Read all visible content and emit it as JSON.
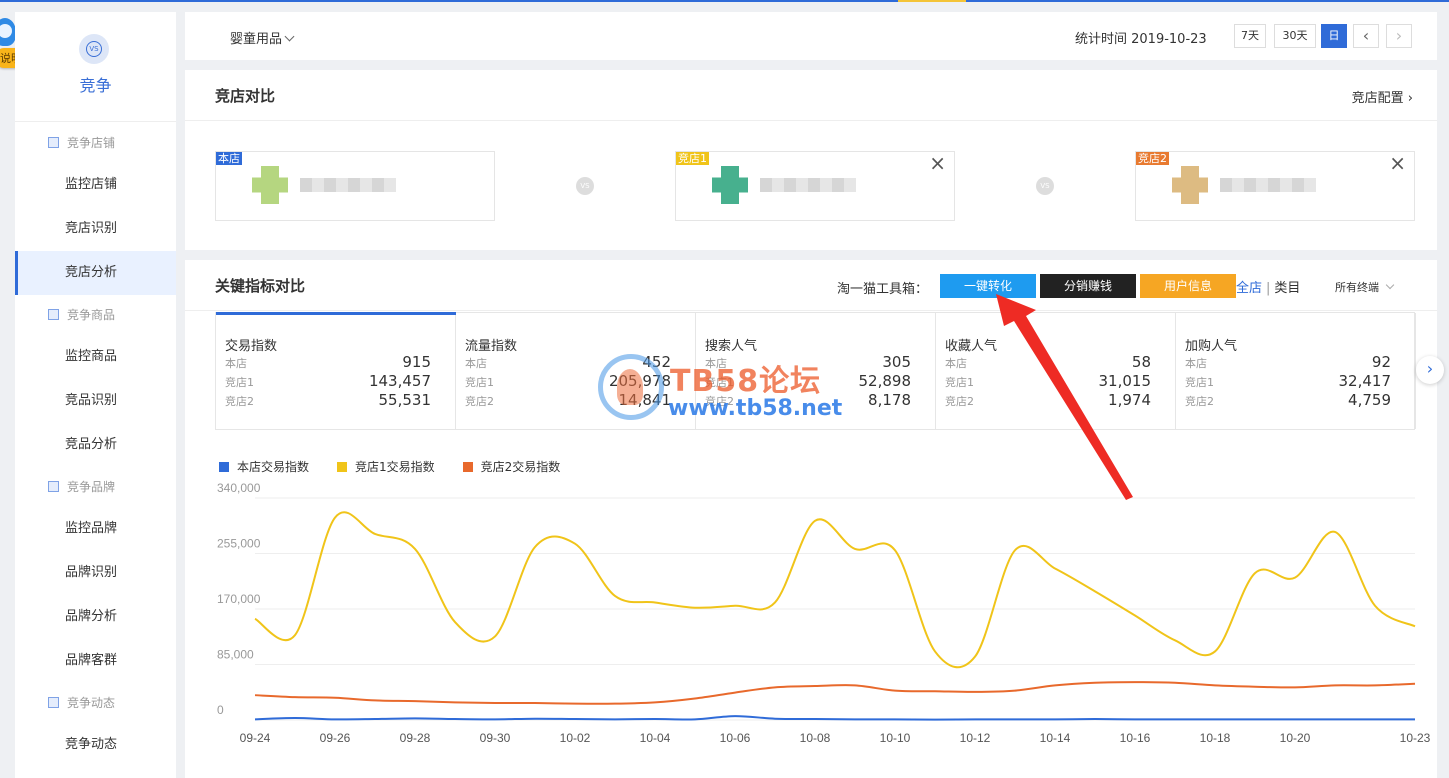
{
  "helper": {
    "tag": "说明"
  },
  "sidebar": {
    "title": "竞争",
    "vs_logo": "VS",
    "sections": [
      {
        "label": "竞争店铺",
        "items": [
          "监控店铺",
          "竞店识别",
          "竞店分析"
        ]
      },
      {
        "label": "竞争商品",
        "items": [
          "监控商品",
          "竞品识别",
          "竞品分析"
        ]
      },
      {
        "label": "竞争品牌",
        "items": [
          "监控品牌",
          "品牌识别",
          "品牌分析",
          "品牌客群"
        ]
      },
      {
        "label": "竞争动态",
        "items": [
          "竞争动态"
        ]
      }
    ],
    "active_item": "竞店分析"
  },
  "filterbar": {
    "category": "婴童用品",
    "stat_time": "统计时间 2019-10-23",
    "range_7": "7天",
    "range_30": "30天",
    "range_day": "日",
    "prev": "‹",
    "next": "›"
  },
  "compare": {
    "title": "竞店对比",
    "config_link": "竞店配置 ›",
    "vs": "VS",
    "shops": [
      {
        "tag": "本店",
        "tag_color": "#2f6bd8",
        "avatar_color": "#a9cf6a"
      },
      {
        "tag": "竞店1",
        "tag_color": "#f0c419",
        "avatar_color": "#27a37b"
      },
      {
        "tag": "竞店2",
        "tag_color": "#e87a30",
        "avatar_color": "#d8b06d"
      }
    ],
    "close": "×"
  },
  "kpi": {
    "title": "关键指标对比",
    "toolbox_label": "淘一猫工具箱：",
    "tools": [
      {
        "label": "一键转化",
        "color": "#1e9bf0"
      },
      {
        "label": "分销赚钱",
        "color": "#222222"
      },
      {
        "label": "用户信息",
        "color": "#f6a623"
      }
    ],
    "scope_all": "全店",
    "scope_sep": "|",
    "scope_cat": "类目",
    "terminal": "所有终端",
    "next_icon": "›",
    "cards": [
      {
        "title": "交易指数",
        "rows": [
          {
            "name": "本店",
            "value": "915"
          },
          {
            "name": "竞店1",
            "value": "143,457"
          },
          {
            "name": "竞店2",
            "value": "55,531"
          }
        ]
      },
      {
        "title": "流量指数",
        "rows": [
          {
            "name": "本店",
            "value": "452"
          },
          {
            "name": "竞店1",
            "value": "205,978"
          },
          {
            "name": "竞店2",
            "value": "14,841"
          }
        ]
      },
      {
        "title": "搜索人气",
        "rows": [
          {
            "name": "本店",
            "value": "305"
          },
          {
            "name": "竞店1",
            "value": "52,898"
          },
          {
            "name": "竞店2",
            "value": "8,178"
          }
        ]
      },
      {
        "title": "收藏人气",
        "rows": [
          {
            "name": "本店",
            "value": "58"
          },
          {
            "name": "竞店1",
            "value": "31,015"
          },
          {
            "name": "竞店2",
            "value": "1,974"
          }
        ]
      },
      {
        "title": "加购人气",
        "rows": [
          {
            "name": "本店",
            "value": "92"
          },
          {
            "name": "竞店1",
            "value": "32,417"
          },
          {
            "name": "竞店2",
            "value": "4,759"
          }
        ]
      }
    ]
  },
  "watermark": {
    "top": "TB58论坛",
    "bottom": "www.tb58.net"
  },
  "chart_data": {
    "type": "line",
    "ylim": [
      0,
      340000
    ],
    "yticks": [
      "340,000",
      "255,000",
      "170,000",
      "85,000",
      "0"
    ],
    "ytick_values": [
      340000,
      255000,
      170000,
      85000,
      0
    ],
    "x": [
      "09-24",
      "09-25",
      "09-26",
      "09-27",
      "09-28",
      "09-29",
      "09-30",
      "10-01",
      "10-02",
      "10-03",
      "10-04",
      "10-05",
      "10-06",
      "10-07",
      "10-08",
      "10-09",
      "10-10",
      "10-11",
      "10-12",
      "10-13",
      "10-14",
      "10-15",
      "10-16",
      "10-17",
      "10-18",
      "10-19",
      "10-20",
      "10-21",
      "10-22",
      "10-23"
    ],
    "xtick_labels": [
      "09-24",
      "09-26",
      "09-28",
      "09-30",
      "10-02",
      "10-04",
      "10-06",
      "10-08",
      "10-10",
      "10-12",
      "10-14",
      "10-16",
      "10-18",
      "10-20",
      "10-23"
    ],
    "series": [
      {
        "name": "本店交易指数",
        "color": "#2f6bd8",
        "values": [
          1000,
          3000,
          1000,
          1500,
          2500,
          1500,
          1000,
          2000,
          1500,
          1000,
          1500,
          1000,
          6000,
          2000,
          1500,
          1000,
          1000,
          500,
          1000,
          1000,
          1000,
          1500,
          1000,
          1000,
          1000,
          1000,
          1000,
          1000,
          1000,
          915
        ]
      },
      {
        "name": "竞店1交易指数",
        "color": "#f0c419",
        "values": [
          155000,
          130000,
          310000,
          285000,
          262000,
          150000,
          128000,
          265000,
          270000,
          190000,
          180000,
          172000,
          175000,
          180000,
          305000,
          262000,
          260000,
          105000,
          97000,
          260000,
          232000,
          197000,
          160000,
          122000,
          105000,
          225000,
          218000,
          288000,
          175000,
          143457
        ]
      },
      {
        "name": "竞店2交易指数",
        "color": "#e8692c",
        "values": [
          38000,
          35000,
          34000,
          30000,
          29000,
          27000,
          26000,
          26000,
          25000,
          25000,
          27000,
          33000,
          42000,
          50000,
          52000,
          53000,
          45000,
          44000,
          43000,
          45000,
          53000,
          57000,
          58000,
          57000,
          53000,
          51000,
          50000,
          53000,
          53000,
          55531
        ]
      }
    ]
  }
}
